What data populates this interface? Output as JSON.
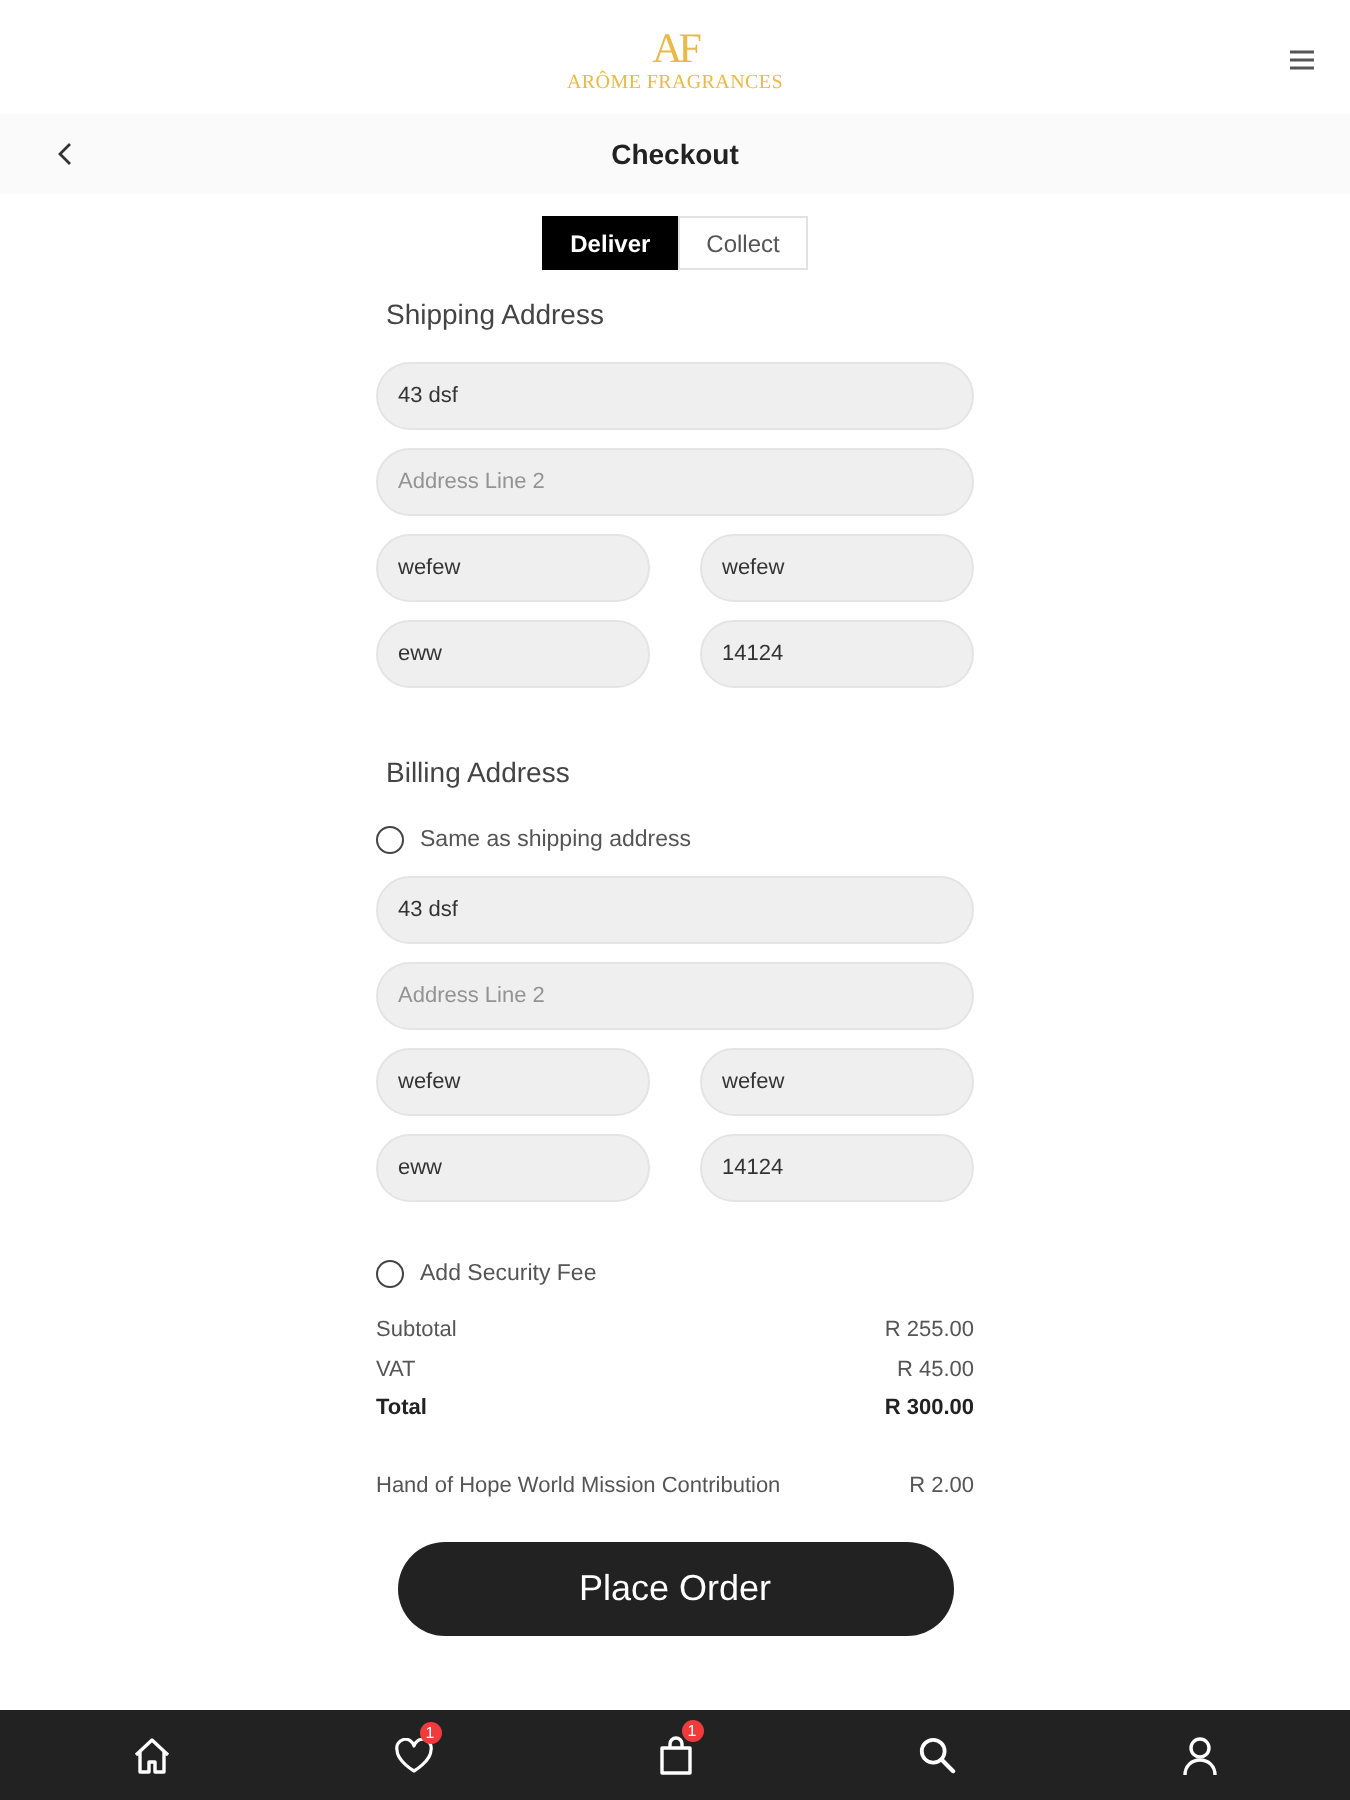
{
  "header": {
    "brand_monogram": "AF",
    "brand_name": "ARÔME FRAGRANCES"
  },
  "page_header": {
    "title": "Checkout"
  },
  "tabs": [
    {
      "label": "Deliver",
      "selected": true
    },
    {
      "label": "Collect",
      "selected": false
    }
  ],
  "shipping_address": {
    "title": "Shipping Address",
    "rows": [
      [
        {
          "value": "43 dsf"
        }
      ],
      [
        {
          "placeholder": "Address Line 2"
        }
      ],
      [
        {
          "value": "wefew"
        },
        {
          "value": "wefew"
        }
      ],
      [
        {
          "value": "eww"
        },
        {
          "value": "14124"
        }
      ]
    ]
  },
  "billing_address": {
    "title": "Billing Address",
    "same_as_shipping": {
      "label": "Same as shipping address",
      "checked": false
    },
    "rows": [
      [
        {
          "value": "43 dsf"
        }
      ],
      [
        {
          "placeholder": "Address Line 2"
        }
      ],
      [
        {
          "value": "wefew"
        },
        {
          "value": "wefew"
        }
      ],
      [
        {
          "value": "eww"
        },
        {
          "value": "14124"
        }
      ]
    ]
  },
  "security_fee": {
    "label": "Add Security Fee",
    "checked": false
  },
  "summary": [
    {
      "label": "Subtotal",
      "value": "R 255.00",
      "kind": "line"
    },
    {
      "label": "VAT",
      "value": "R 45.00",
      "kind": "line"
    },
    {
      "label": "Total",
      "value": "R 300.00",
      "kind": "total"
    }
  ],
  "contribution": {
    "label": "Hand of Hope World Mission Contribution",
    "value": "R 2.00"
  },
  "place_order_button": "Place Order",
  "bottom_nav": [
    {
      "kind": "home"
    },
    {
      "kind": "favorites",
      "badge": "1"
    },
    {
      "kind": "cart",
      "badge": "1"
    },
    {
      "kind": "search"
    },
    {
      "kind": "account"
    }
  ]
}
